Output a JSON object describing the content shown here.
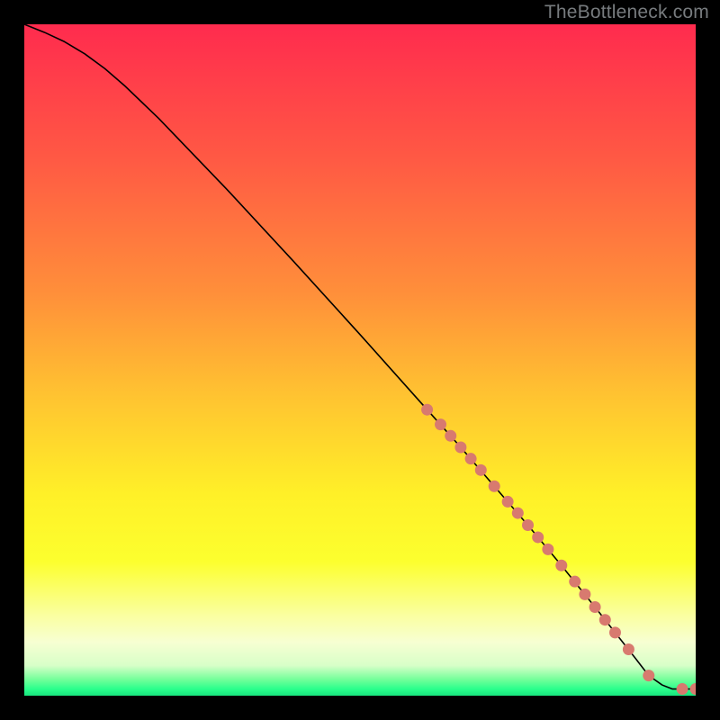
{
  "watermark": "TheBottleneck.com",
  "chart_data": {
    "type": "line",
    "title": "",
    "xlabel": "",
    "ylabel": "",
    "xlim": [
      0,
      100
    ],
    "ylim": [
      0,
      100
    ],
    "gradient_stops": [
      {
        "offset": 0.0,
        "color": "#ff2b4e"
      },
      {
        "offset": 0.2,
        "color": "#ff5944"
      },
      {
        "offset": 0.4,
        "color": "#ff8f3a"
      },
      {
        "offset": 0.55,
        "color": "#ffc231"
      },
      {
        "offset": 0.7,
        "color": "#fff028"
      },
      {
        "offset": 0.8,
        "color": "#fcff2e"
      },
      {
        "offset": 0.88,
        "color": "#faffa0"
      },
      {
        "offset": 0.92,
        "color": "#f7ffd2"
      },
      {
        "offset": 0.955,
        "color": "#d8ffc8"
      },
      {
        "offset": 0.975,
        "color": "#77ff9b"
      },
      {
        "offset": 0.99,
        "color": "#2aff8c"
      },
      {
        "offset": 1.0,
        "color": "#18e47e"
      }
    ],
    "series": [
      {
        "name": "curve",
        "type": "line",
        "x": [
          0,
          3,
          6,
          9,
          12,
          15,
          20,
          30,
          40,
          50,
          60,
          65,
          70,
          75,
          80,
          85,
          88,
          91,
          93,
          95,
          96.5,
          98,
          100
        ],
        "y": [
          100,
          98.8,
          97.4,
          95.6,
          93.4,
          90.8,
          86.0,
          75.6,
          64.8,
          53.8,
          42.6,
          37.0,
          31.2,
          25.4,
          19.4,
          13.2,
          9.4,
          5.6,
          3.0,
          1.6,
          1.0,
          1.0,
          1.0
        ]
      },
      {
        "name": "points-on-curve",
        "type": "scatter",
        "marker_color": "#d87a6f",
        "x": [
          60,
          62,
          63.5,
          65,
          66.5,
          68,
          70,
          72,
          73.5,
          75,
          76.5,
          78,
          80,
          82,
          83.5,
          85,
          86.5,
          88,
          90,
          93,
          98,
          100
        ],
        "y": [
          42.6,
          40.4,
          38.7,
          37.0,
          35.3,
          33.6,
          31.2,
          28.9,
          27.2,
          25.4,
          23.6,
          21.8,
          19.4,
          17.0,
          15.1,
          13.2,
          11.3,
          9.4,
          6.9,
          3.0,
          1.0,
          1.0
        ]
      }
    ]
  }
}
